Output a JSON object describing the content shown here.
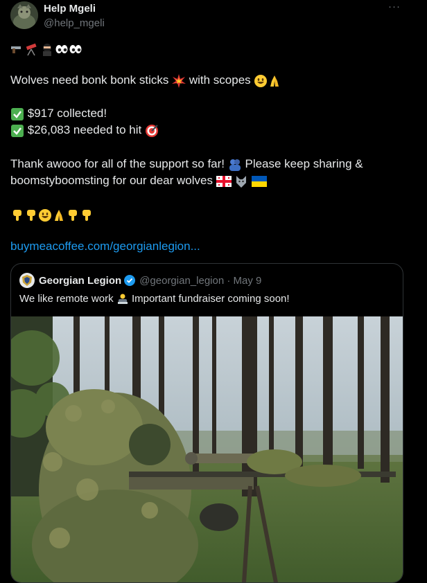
{
  "author": {
    "name": "Help Mgeli",
    "handle": "@help_mgeli"
  },
  "menu": {
    "more_label": "···"
  },
  "tweet": {
    "line1": "Wolves need bonk bonk sticks",
    "line1b": "with scopes",
    "collected": "$917 collected!",
    "needed": "$26,083 needed to hit",
    "thanks1": "Thank awooo for all of the support so far!",
    "thanks1b": "Please keep sharing &",
    "thanks2": "boomstyboomsting for our dear wolves",
    "link": "buymeacoffee.com/georgianlegion..."
  },
  "quote": {
    "name": "Georgian Legion",
    "handle": "@georgian_legion · May 9",
    "text_a": "We like remote work",
    "text_b": "Important fundraiser coming soon!"
  },
  "colors": {
    "background": "#000000",
    "text": "#e7e9ea",
    "secondary": "#71767b",
    "link": "#1d9bf0",
    "border": "#2f3336",
    "verified": "#1d9bf0"
  }
}
